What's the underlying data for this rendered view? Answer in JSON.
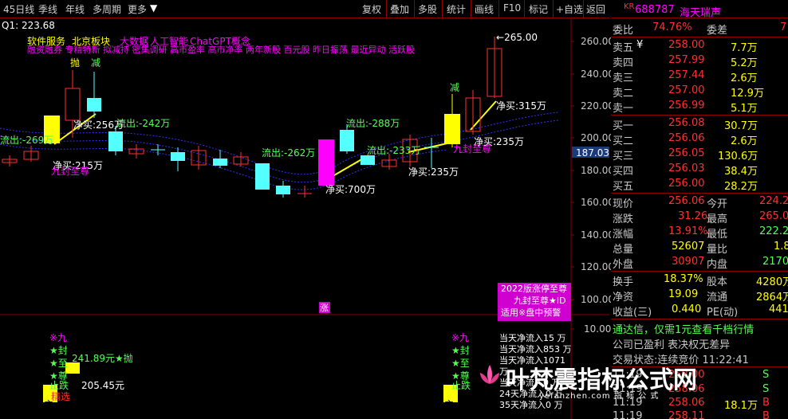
{
  "toolbar": {
    "left": [
      "45日线",
      "季线",
      "年线",
      "多周期",
      "更多"
    ],
    "right": [
      "复权",
      "叠加",
      "多股",
      "统计",
      "画线",
      "F10",
      "标记",
      "+自选",
      "返回"
    ]
  },
  "chart": {
    "q1_label": "Q1: 223.68",
    "concepts_line1": [
      "软件服务",
      "北京板块",
      "大数据",
      "人工智能",
      "ChatGPT概念"
    ],
    "concepts_line2": "融资融券 专精特新 拟减持 密集调研 高市盈率 高市净率 两年新股 百元股 昨日振荡 最近异动 活跃股",
    "price_axis": [
      "260.00",
      "240.00",
      "220.00",
      "200.00",
      "180.00",
      "160.00",
      "140.00",
      "120.00",
      "100.00",
      "10.00"
    ],
    "current_price_tag": "187.03",
    "high_label": "265.00",
    "annotations": {
      "pao": "抛",
      "jian1": "减",
      "jian2": "减",
      "jm_215": "净买:215万",
      "jm_256": "净买:256万",
      "lc_242": "流出:-242万",
      "lc_269": "流出:-269万",
      "jiufeng1": "九封至尊",
      "lc_262": "流出:-262万",
      "jm_700": "净买:700万",
      "lc_288": "流出:-288万",
      "lc_233": "流出:-233万",
      "jm_235a": "净买:235万",
      "jiufeng2": "九封至尊",
      "jm_235b": "净买:235万",
      "jm_315": "净买:315万",
      "zhang": "涨"
    },
    "promo": {
      "l1": "2022版涨停至尊",
      "l2": "九封至尊★ID",
      "l3": "适用※盘中预警"
    },
    "lower": {
      "l_jiu": "※九",
      "l_feng": "★封",
      "l_zhi": "★至",
      "l_zun": "★尊",
      "pao_line": "241.89元★抛",
      "die_line": "止跌",
      "jing_line": "精选",
      "price2": "205.45元",
      "r_jiu": "※九",
      "r_feng": "★封",
      "r_zhi": "★至",
      "r_zun": "★尊",
      "r_die": "止跌",
      "zhu": "主",
      "flows": [
        "当天净流入15 万",
        "当天净流入853 万",
        "当天净流入1071 万",
        "当天净流入0 万",
        "24天净流入0 万",
        "35天净流入0 万"
      ]
    },
    "watermark": "叶梵震指标公式网",
    "watermark_sub": "yefanzhen.com  指 标 公 式"
  },
  "quote": {
    "code_prefix": "KR",
    "code": "688787",
    "name": "海天瑞声",
    "weibi_label": "委比",
    "weibi": "74.76%",
    "weicha_label": "委差",
    "weicha": "7",
    "asks": [
      {
        "label": "卖五",
        "mark": "¥",
        "price": "258.00",
        "vol": "7.7万"
      },
      {
        "label": "卖四",
        "mark": "",
        "price": "257.99",
        "vol": "5.2万"
      },
      {
        "label": "卖三",
        "mark": "",
        "price": "257.44",
        "vol": "2.6万"
      },
      {
        "label": "卖二",
        "mark": "",
        "price": "257.00",
        "vol": "12.9万"
      },
      {
        "label": "卖一",
        "mark": "",
        "price": "256.99",
        "vol": "5.1万"
      }
    ],
    "bids": [
      {
        "label": "买一",
        "price": "256.08",
        "vol": "30.7万"
      },
      {
        "label": "买二",
        "price": "256.06",
        "vol": "2.6万"
      },
      {
        "label": "买三",
        "price": "256.05",
        "vol": "130.6万"
      },
      {
        "label": "买四",
        "price": "256.03",
        "vol": "38.4万"
      },
      {
        "label": "买五",
        "price": "256.00",
        "vol": "28.2万"
      }
    ],
    "stats": [
      {
        "l1": "现价",
        "v1": "256.06",
        "l2": "今开",
        "v2": "224.2"
      },
      {
        "l1": "涨跌",
        "v1": "31.26",
        "l2": "最高",
        "v2": "265.0"
      },
      {
        "l1": "涨幅",
        "v1": "13.91%",
        "l2": "最低",
        "v2": "222.2"
      },
      {
        "l1": "总量",
        "v1": "52607",
        "l2": "量比",
        "v2": "1.8"
      },
      {
        "l1": "外盘",
        "v1": "30907",
        "l2": "内盘",
        "v2": "2170"
      }
    ],
    "stats2": [
      {
        "l1": "换手",
        "v1": "18.37%",
        "l2": "股本",
        "v2": "4280万"
      },
      {
        "l1": "净资",
        "v1": "19.09",
        "l2": "流通",
        "v2": "2864万"
      },
      {
        "l1": "收益(三)",
        "v1": "0.440",
        "l2": "PE(动)",
        "v2": "441"
      }
    ],
    "notice1": "通达信，仅需1元查看千档行情",
    "notice2": "公司已盈利 表决权无差异",
    "notice3": "交易状态:连续竞价 11:22:41",
    "ticks": [
      {
        "time": "11:19",
        "price": "258.00",
        "vol": "",
        "flag": "S"
      },
      {
        "time": "11:19",
        "price": "258.06",
        "vol": "",
        "flag": "S"
      },
      {
        "time": "11:19",
        "price": "258.06",
        "vol": "18.1万",
        "flag": "B"
      },
      {
        "time": "11:19",
        "price": "258.11",
        "vol": "",
        "flag": "B"
      }
    ]
  },
  "colors": {
    "up": "#ff3030",
    "down": "#54ffff",
    "yellow": "#ffff00",
    "magenta": "#ff00ff",
    "bg": "#000000"
  }
}
